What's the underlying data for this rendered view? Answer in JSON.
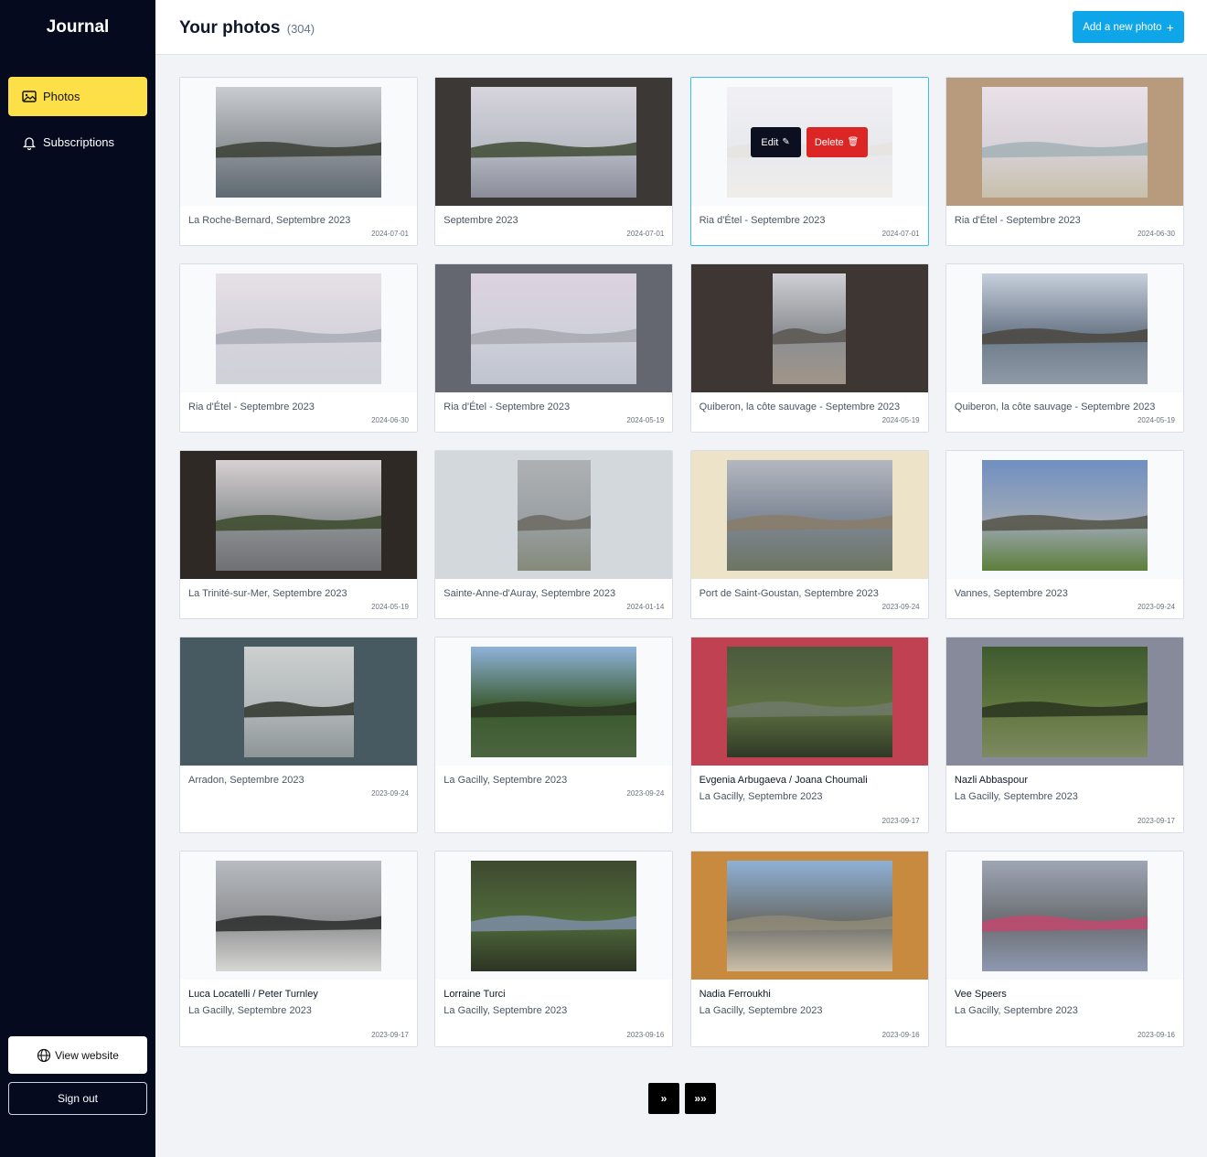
{
  "sidebar": {
    "brand": "Journal",
    "items": [
      {
        "label": "Photos",
        "icon": "image-icon",
        "active": true
      },
      {
        "label": "Subscriptions",
        "icon": "bell-icon",
        "active": false
      }
    ],
    "view_website": "View website",
    "sign_out": "Sign out"
  },
  "header": {
    "title": "Your photos",
    "count": "(304)",
    "add_button": "Add a new photo",
    "add_icon": "+"
  },
  "overlay": {
    "edit": "Edit",
    "delete": "Delete"
  },
  "photos": [
    {
      "title": "",
      "place": "La Roche-Bernard, Septembre 2023",
      "date": "2024-07-01",
      "bg": "#f8fafc",
      "w": 181
    },
    {
      "title": "",
      "place": "Septembre 2023",
      "date": "2024-07-01",
      "bg": "#3c3836",
      "w": 181
    },
    {
      "title": "",
      "place": "Ria d'Étel - Septembre 2023",
      "date": "2024-07-01",
      "bg": "#f8fafc",
      "w": 181
    },
    {
      "title": "",
      "place": "Ria d'Étel - Septembre 2023",
      "date": "2024-06-30",
      "bg": "#b89b7d",
      "w": 181
    },
    {
      "title": "",
      "place": "Ria d'Étel - Septembre 2023",
      "date": "2024-06-30",
      "bg": "#f8fafc",
      "w": 181
    },
    {
      "title": "",
      "place": "Ria d'Étel - Septembre 2023",
      "date": "2024-05-19",
      "bg": "#646670",
      "w": 181
    },
    {
      "title": "",
      "place": "Quiberon, la côte sauvage - Septembre 2023",
      "date": "2024-05-19",
      "bg": "#3e3633",
      "w": 80
    },
    {
      "title": "",
      "place": "Quiberon, la côte sauvage - Septembre 2023",
      "date": "2024-05-19",
      "bg": "#f8fafc",
      "w": 181
    },
    {
      "title": "",
      "place": "La Trinité-sur-Mer, Septembre 2023",
      "date": "2024-05-19",
      "bg": "#2e2924",
      "w": 181
    },
    {
      "title": "",
      "place": "Sainte-Anne-d'Auray, Septembre 2023",
      "date": "2024-01-14",
      "bg": "#d3d8dc",
      "w": 80
    },
    {
      "title": "",
      "place": "Port de Saint-Goustan, Septembre 2023",
      "date": "2023-09-24",
      "bg": "#ede3c8",
      "w": 181
    },
    {
      "title": "",
      "place": "Vannes, Septembre 2023",
      "date": "2023-09-24",
      "bg": "#f8fafc",
      "w": 181
    },
    {
      "title": "",
      "place": "Arradon, Septembre 2023",
      "date": "2023-09-24",
      "bg": "#475a62",
      "w": 120
    },
    {
      "title": "",
      "place": "La Gacilly, Septembre 2023",
      "date": "2023-09-24",
      "bg": "#f8fafc",
      "w": 181
    },
    {
      "title": "Evgenia Arbugaeva / Joana Choumali",
      "place": "La Gacilly, Septembre 2023",
      "date": "2023-09-17",
      "bg": "#bf4152",
      "w": 181
    },
    {
      "title": "Nazli Abbaspour",
      "place": "La Gacilly, Septembre 2023",
      "date": "2023-09-17",
      "bg": "#868a9b",
      "w": 181
    },
    {
      "title": "Luca Locatelli / Peter Turnley",
      "place": "La Gacilly, Septembre 2023",
      "date": "2023-09-17",
      "bg": "#f8fafc",
      "w": 181
    },
    {
      "title": "Lorraine Turci",
      "place": "La Gacilly, Septembre 2023",
      "date": "2023-09-16",
      "bg": "#f8fafc",
      "w": 181
    },
    {
      "title": "Nadia Ferroukhi",
      "place": "La Gacilly, Septembre 2023",
      "date": "2023-09-16",
      "bg": "#c78a3e",
      "w": 181
    },
    {
      "title": "Vee Speers",
      "place": "La Gacilly, Septembre 2023",
      "date": "2023-09-16",
      "bg": "#f8fafc",
      "w": 181
    }
  ],
  "pagination": {
    "next": "»",
    "last": "»»"
  }
}
